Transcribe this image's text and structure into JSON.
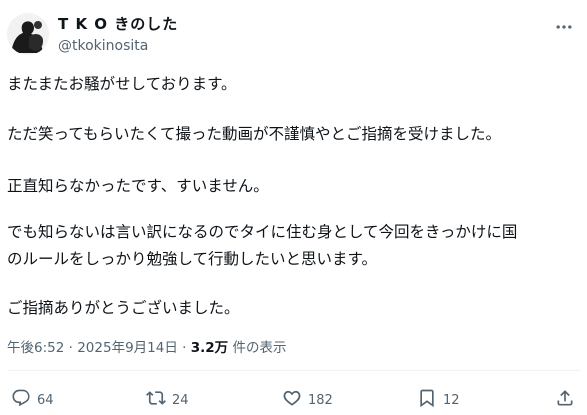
{
  "author": {
    "display_name": "T K O きのした",
    "handle": "@tkokinosita"
  },
  "post": {
    "lines": [
      "またまたお騒がせしております。",
      "ただ笑ってもらいたくて撮った動画が不謹慎やとご指摘を受けました。",
      "正直知らなかったです、すいません。",
      "でも知らないは言い訳になるのでタイに住む身として今回をきっかけに国",
      "のルールをしっかり勉強して行動したいと思います。",
      "ご指摘ありがとうございました。"
    ]
  },
  "meta": {
    "time": "午後6:52",
    "date": "2025年9月14日",
    "separator": "·",
    "views": "3.2万",
    "views_suffix": "件の表示"
  },
  "actions": {
    "replies": "64",
    "retweets": "24",
    "likes": "182",
    "bookmarks": "12"
  },
  "icons": [
    "more-icon",
    "reply-icon",
    "retweet-icon",
    "like-icon",
    "bookmark-icon",
    "share-icon"
  ],
  "colors": {
    "text": "#0f1419",
    "muted": "#536471",
    "divider": "#eff3f4"
  }
}
